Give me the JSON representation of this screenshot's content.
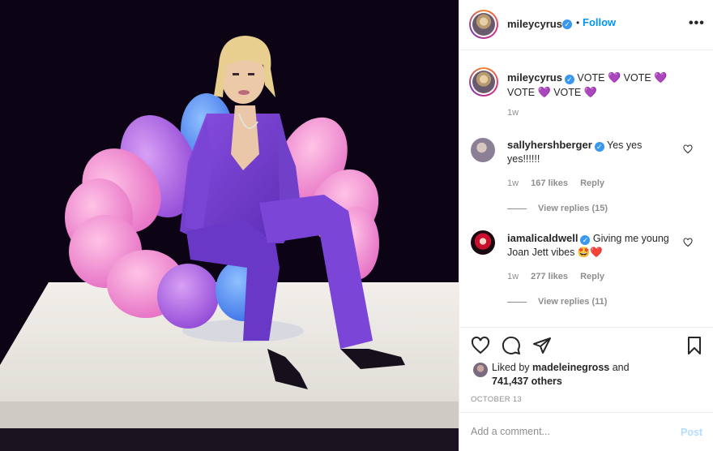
{
  "header": {
    "username": "mileycyrus",
    "separator": "•",
    "follow_label": "Follow",
    "more_icon": "more-horizontal-icon"
  },
  "caption": {
    "username": "mileycyrus",
    "text_parts": [
      "VOTE",
      "VOTE",
      "VOTE",
      "VOTE"
    ],
    "heart": "💜",
    "time": "1w"
  },
  "comments": [
    {
      "username": "sallyhershberger",
      "text": "Yes yes yes!!!!!!",
      "time": "1w",
      "likes": "167 likes",
      "reply": "Reply",
      "view_replies": "View replies (15)"
    },
    {
      "username": "iamalicaldwell",
      "text": "Giving me young Joan Jett vibes 🤩❤️",
      "time": "1w",
      "likes": "277 likes",
      "reply": "Reply",
      "view_replies": "View replies (11)"
    }
  ],
  "likes": {
    "prefix": "Liked by",
    "user": "madeleinegross",
    "middle": "and",
    "count": "741,437 others"
  },
  "date": "OCTOBER 13",
  "add_comment": {
    "placeholder": "Add a comment...",
    "post_label": "Post"
  },
  "colors": {
    "link_blue": "#0095f6",
    "verified_blue": "#3897f0",
    "muted_text": "#8e8e8e",
    "like_red": "#ed4956"
  }
}
